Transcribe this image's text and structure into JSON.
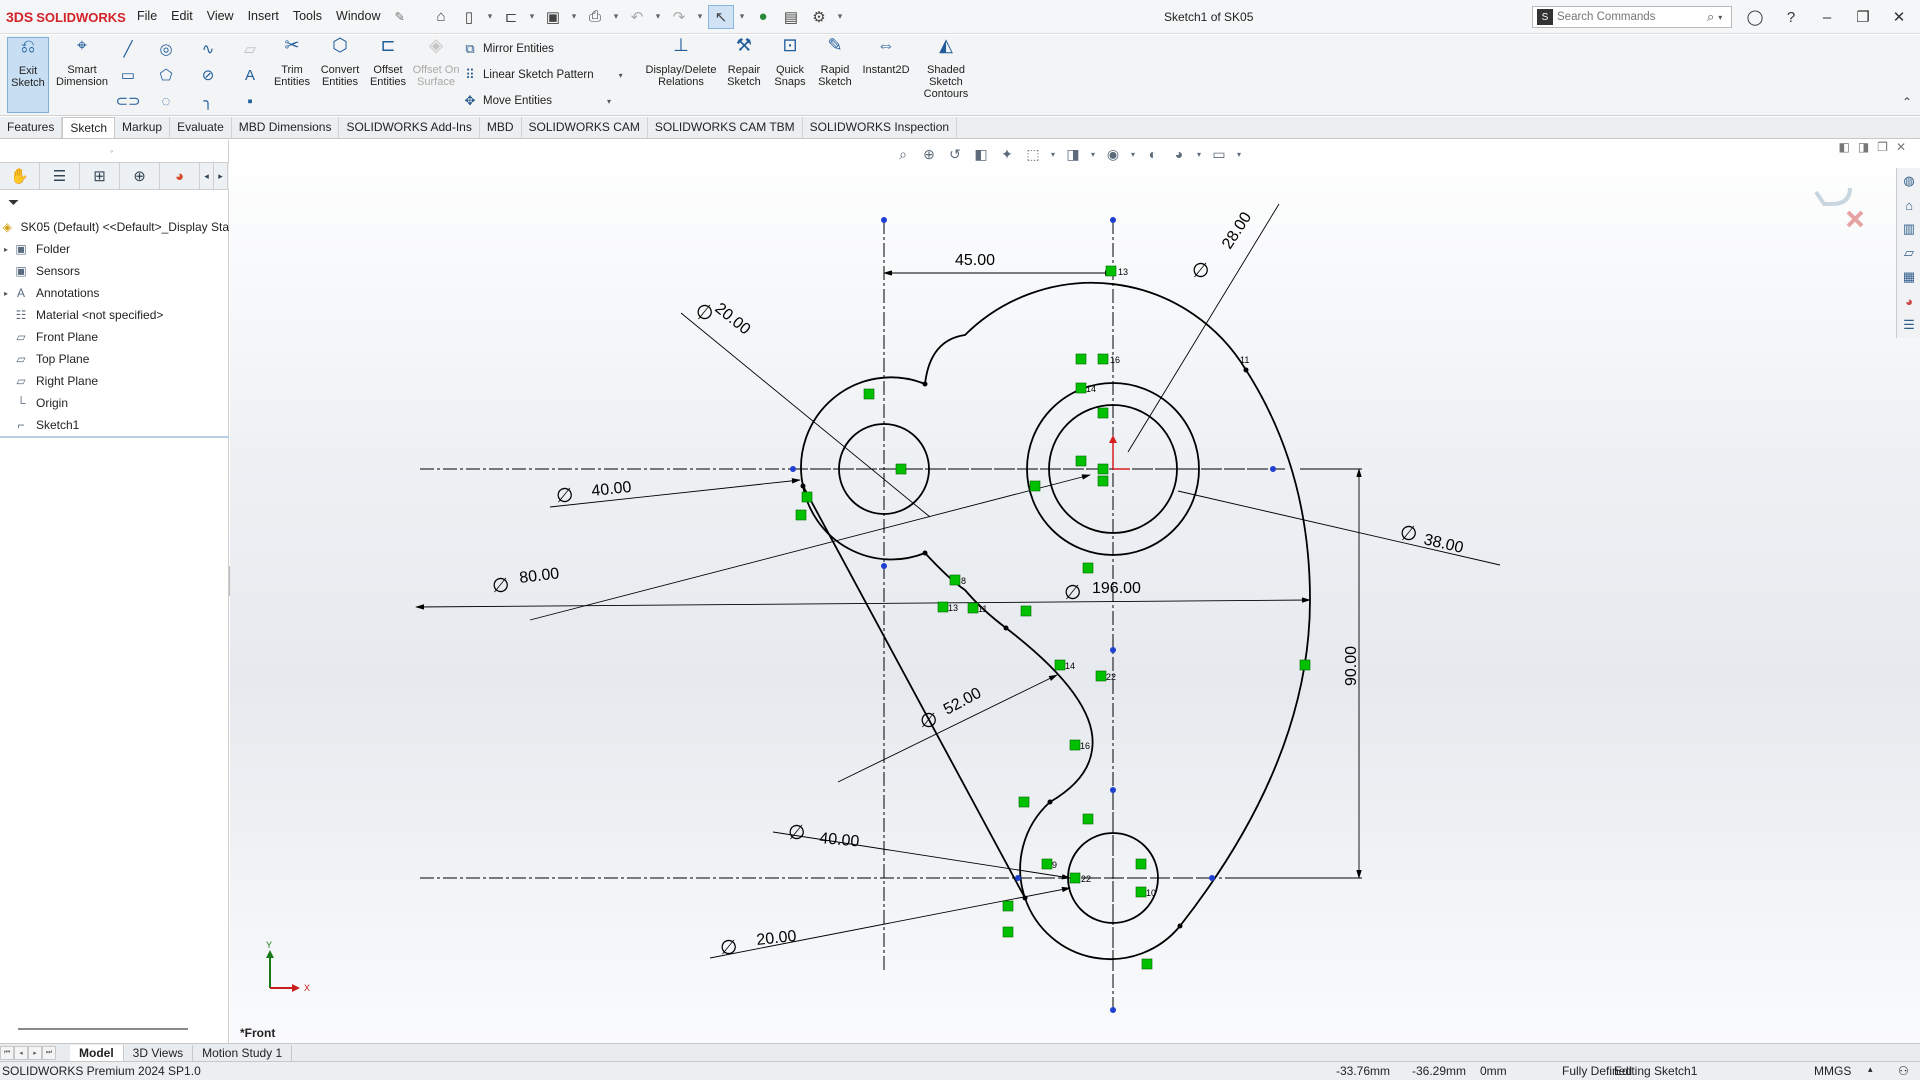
{
  "app": {
    "brand_ds": "3DS",
    "brand_name": "SOLIDWORKS",
    "doc_title": "Sketch1 of SK05"
  },
  "menu": [
    "File",
    "Edit",
    "View",
    "Insert",
    "Tools",
    "Window"
  ],
  "search": {
    "placeholder": "Search Commands"
  },
  "commands": {
    "exit_sketch": "Exit Sketch",
    "smart_dimension": "Smart Dimension",
    "trim_entities": "Trim Entities",
    "convert_entities": "Convert Entities",
    "offset_entities": "Offset Entities",
    "offset_on_surface": "Offset On Surface",
    "mirror_entities": "Mirror Entities",
    "linear_sketch_pattern": "Linear Sketch Pattern",
    "move_entities": "Move Entities",
    "display_delete_relations": "Display/Delete Relations",
    "repair_sketch": "Repair Sketch",
    "quick_snaps": "Quick Snaps",
    "rapid_sketch": "Rapid Sketch",
    "instant2d": "Instant2D",
    "shaded_sketch_contours": "Shaded Sketch Contours"
  },
  "tabs": [
    "Features",
    "Sketch",
    "Markup",
    "Evaluate",
    "MBD Dimensions",
    "SOLIDWORKS Add-Ins",
    "MBD",
    "SOLIDWORKS CAM",
    "SOLIDWORKS CAM TBM",
    "SOLIDWORKS Inspection"
  ],
  "active_tab": "Sketch",
  "tree": {
    "root": "SK05 (Default) <<Default>_Display Sta",
    "items": [
      {
        "label": "Folder",
        "icon": "folder-icon",
        "expandable": true
      },
      {
        "label": "Sensors",
        "icon": "sensor-icon",
        "expandable": false
      },
      {
        "label": "Annotations",
        "icon": "annotation-icon",
        "expandable": true
      },
      {
        "label": "Material <not specified>",
        "icon": "material-icon",
        "expandable": false
      },
      {
        "label": "Front Plane",
        "icon": "plane-icon",
        "expandable": false
      },
      {
        "label": "Top Plane",
        "icon": "plane-icon",
        "expandable": false
      },
      {
        "label": "Right Plane",
        "icon": "plane-icon",
        "expandable": false
      },
      {
        "label": "Origin",
        "icon": "origin-icon",
        "expandable": false
      },
      {
        "label": "Sketch1",
        "icon": "sketch-icon",
        "expandable": false
      }
    ]
  },
  "graphics": {
    "view_name": "*Front",
    "axis_x": "X",
    "axis_y": "Y",
    "dimensions": [
      "45.00",
      "28.00",
      "20.00",
      "40.00",
      "38.00",
      "80.00",
      "196.00",
      "90.00",
      "52.00",
      "40.00",
      "20.00"
    ],
    "relation_tags": [
      "13",
      "11",
      "16",
      "14",
      "8",
      "13",
      "11",
      "14",
      "22",
      "16",
      "9",
      "22",
      "10"
    ]
  },
  "model_tabs": [
    "Model",
    "3D Views",
    "Motion Study 1"
  ],
  "active_model_tab": "Model",
  "status": {
    "product": "SOLIDWORKS Premium 2024 SP1.0",
    "x": "-33.76mm",
    "y": "-36.29mm",
    "z": "0mm",
    "state": "Fully Defined",
    "editing": "Editing Sketch1",
    "units": "MMGS"
  },
  "colors": {
    "brand_red": "#d2232a",
    "sketch_line": "#000000",
    "relation_green": "#00c000",
    "selection_blue": "#1f5d9b"
  }
}
